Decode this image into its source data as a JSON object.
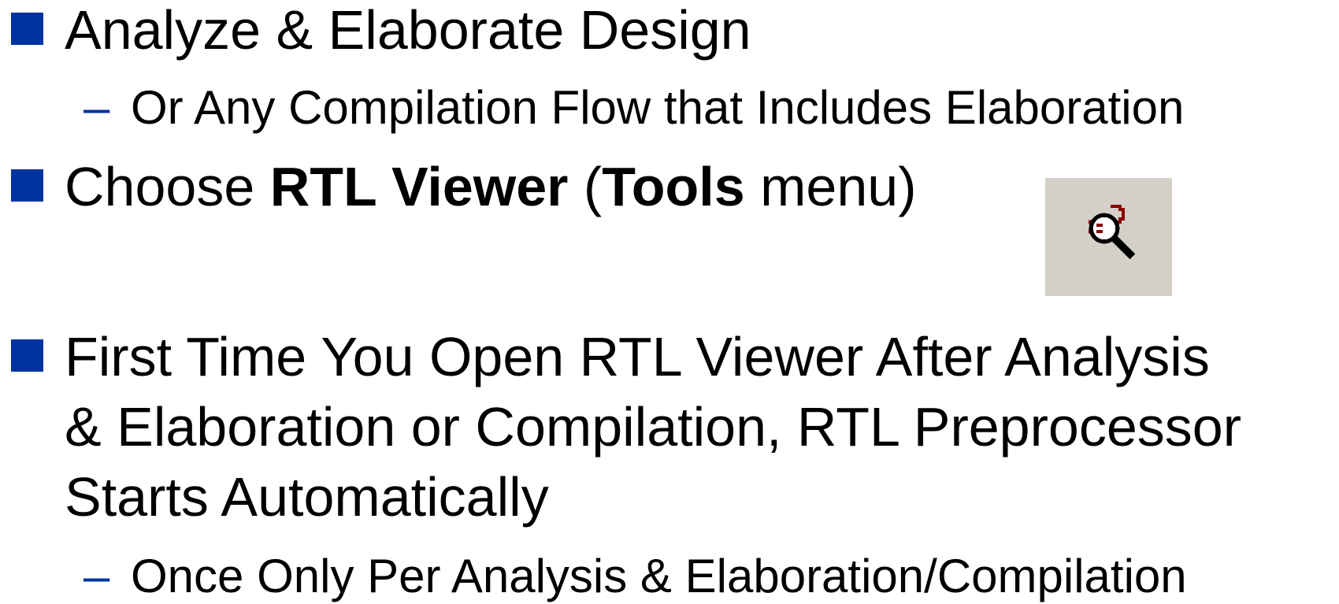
{
  "bullets": {
    "b1": {
      "text": "Analyze & Elaborate Design",
      "sub": "Or Any Compilation Flow that Includes Elaboration"
    },
    "b2": {
      "prefix": "Choose ",
      "bold1": "RTL Viewer",
      "mid": " (",
      "bold2": "Tools",
      "suffix": " menu)"
    },
    "b3": {
      "line1": "First Time You Open RTL Viewer After Analysis",
      "line2": "& Elaboration or Compilation, RTL Preprocessor",
      "line3": "Starts Automatically",
      "sub": "Once Only Per Analysis & Elaboration/Compilation"
    },
    "dash": "–"
  },
  "icon": {
    "name": "rtl-viewer-icon"
  },
  "colors": {
    "bullet": "#0033a0",
    "icon_bg": "#d4d0c8",
    "icon_red": "#8b0000"
  }
}
